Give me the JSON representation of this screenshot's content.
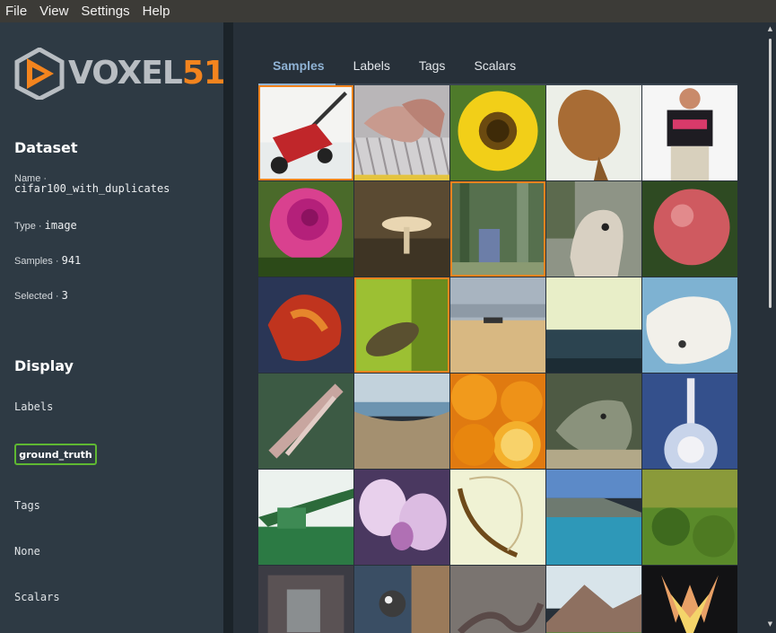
{
  "menubar": {
    "items": [
      "File",
      "View",
      "Settings",
      "Help"
    ]
  },
  "sidebar": {
    "logo": {
      "text_a": "VOXEL",
      "text_b": "51"
    },
    "dataset": {
      "title": "Dataset",
      "name_label": "Name ·",
      "name_value": "cifar100_with_duplicates",
      "type_label": "Type ·",
      "type_value": "image",
      "samples_label": "Samples ·",
      "samples_value": "941",
      "selected_label": "Selected ·",
      "selected_value": "3"
    },
    "display": {
      "title": "Display",
      "labels_title": "Labels",
      "label_chip": "ground_truth",
      "tags_title": "Tags",
      "tags_value": "None",
      "scalars_title": "Scalars"
    }
  },
  "main": {
    "tabs": [
      "Samples",
      "Labels",
      "Tags",
      "Scalars"
    ],
    "active_tab": "Samples",
    "tiles": [
      {
        "name": "lawn-mower",
        "selected": true
      },
      {
        "name": "keyboard-hands",
        "selected": false
      },
      {
        "name": "sunflower",
        "selected": false
      },
      {
        "name": "flatfish",
        "selected": false
      },
      {
        "name": "man",
        "selected": false
      },
      {
        "name": "rose",
        "selected": false
      },
      {
        "name": "mushroom",
        "selected": false
      },
      {
        "name": "forest-person",
        "selected": true
      },
      {
        "name": "camel",
        "selected": false
      },
      {
        "name": "apple",
        "selected": false
      },
      {
        "name": "crab",
        "selected": false
      },
      {
        "name": "caterpillar",
        "selected": true
      },
      {
        "name": "plain",
        "selected": false
      },
      {
        "name": "sea-horizon",
        "selected": false
      },
      {
        "name": "polar-bear",
        "selected": false
      },
      {
        "name": "rocket-stick",
        "selected": false
      },
      {
        "name": "beach-cliff",
        "selected": false
      },
      {
        "name": "oranges",
        "selected": false
      },
      {
        "name": "rock-animal",
        "selected": false
      },
      {
        "name": "rocket",
        "selected": false
      },
      {
        "name": "tank",
        "selected": false
      },
      {
        "name": "orchid",
        "selected": false
      },
      {
        "name": "necklace",
        "selected": false
      },
      {
        "name": "coast",
        "selected": false
      },
      {
        "name": "green-field",
        "selected": false
      },
      {
        "name": "machine",
        "selected": false
      },
      {
        "name": "raccoon",
        "selected": false
      },
      {
        "name": "lizard-rock",
        "selected": false
      },
      {
        "name": "mountain",
        "selected": false
      },
      {
        "name": "tulip",
        "selected": false
      }
    ]
  },
  "colors": {
    "accent": "#f3841e",
    "chip_border": "#5fb832",
    "tab_active": "#8fb2d4",
    "sidebar_bg": "#2e3a44"
  }
}
